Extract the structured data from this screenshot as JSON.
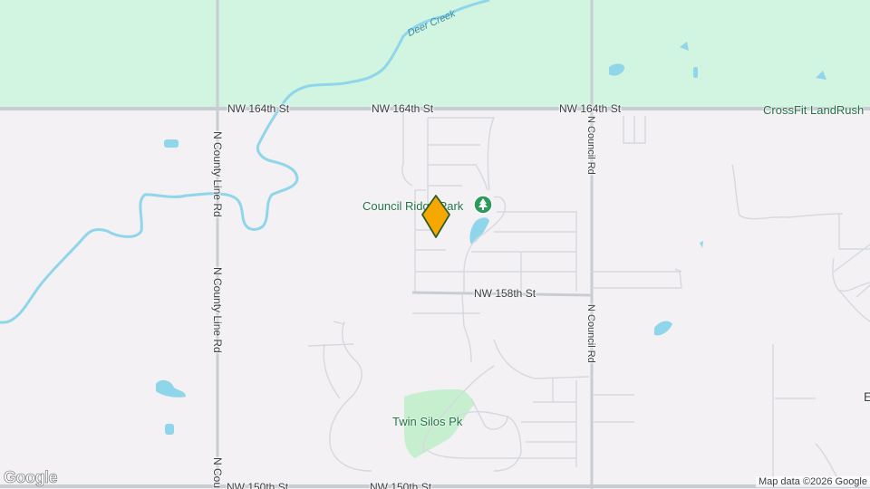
{
  "roads": {
    "nw164_a": "NW 164th St",
    "nw164_b": "NW 164th St",
    "nw164_c": "NW 164th St",
    "nw158": "NW 158th St",
    "nw150_a": "NW 150th St",
    "nw150_b": "NW 150th St",
    "county_line_a": "N County Line Rd",
    "county_line_b": "N County Line Rd",
    "county_line_c": "N Cou",
    "council_a": "N Council Rd",
    "council_b": "N Council Rd"
  },
  "water": {
    "deer_creek": "Deer Creek"
  },
  "places": {
    "council_ridge_park": "Council Ridge Park",
    "twin_silos": "Twin Silos Pk",
    "crossfit": "CrossFit LandRush",
    "edge_label": "E"
  },
  "marker": {
    "color": "#f6a800",
    "icon": "map-pin-marker"
  },
  "park_icon": "tree-icon",
  "logo": "Google",
  "attribution": "Map data ©2026 Google",
  "colors": {
    "land": "#f3f1f3",
    "farmland": "#d1f5e1",
    "water": "#8fd6ea",
    "park": "#c5efcf"
  }
}
